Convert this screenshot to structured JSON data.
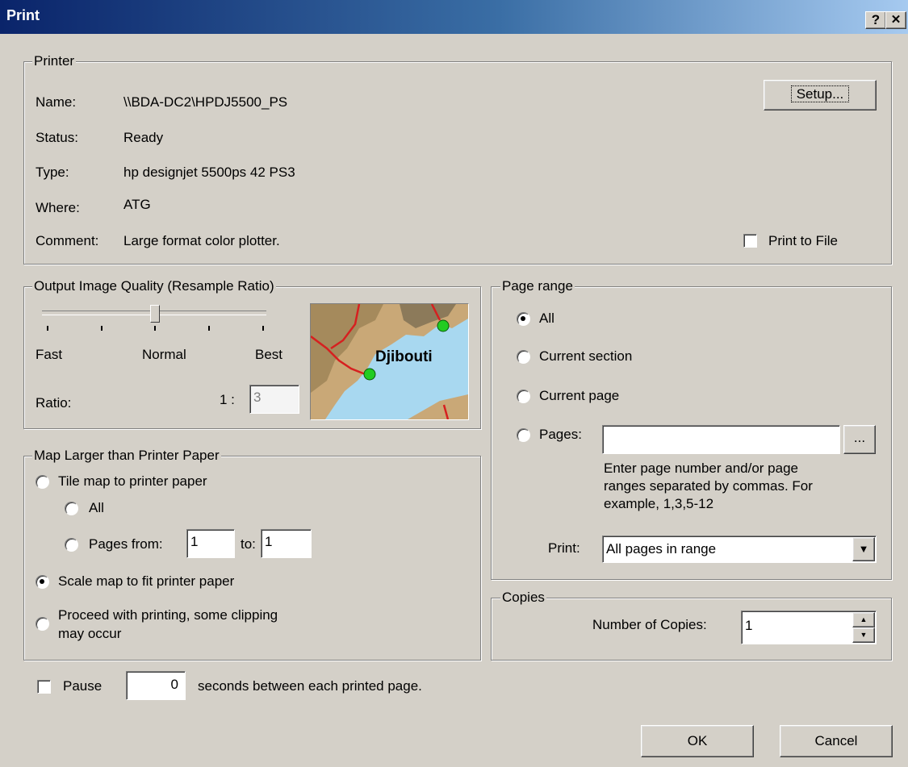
{
  "window": {
    "title": "Print",
    "help_label": "?",
    "close_label": "✕"
  },
  "printer": {
    "legend": "Printer",
    "labels": {
      "name": "Name:",
      "status": "Status:",
      "type": "Type:",
      "where": "Where:",
      "comment": "Comment:"
    },
    "values": {
      "name": "\\\\BDA-DC2\\HPDJ5500_PS",
      "status": "Ready",
      "type": "hp designjet 5500ps 42 PS3",
      "where": "ATG",
      "comment": "Large format color plotter."
    },
    "setup_label": "Setup...",
    "print_to_file_label": "Print to File",
    "print_to_file_checked": false
  },
  "quality": {
    "legend": "Output Image Quality (Resample Ratio)",
    "fast": "Fast",
    "normal": "Normal",
    "best": "Best",
    "slider_level": 0.5,
    "ratio_label": "Ratio:",
    "ratio_prefix": "1 :",
    "ratio_value": "3",
    "preview_label": "Djibouti"
  },
  "map_larger": {
    "legend": "Map Larger than Printer Paper",
    "tile_label": "Tile map to printer paper",
    "all_label": "All",
    "pages_from_label": "Pages from:",
    "pages_from_value": "1",
    "to_label": "to:",
    "to_value": "1",
    "scale_label": "Scale map to fit printer paper",
    "proceed_label_1": "Proceed with printing, some clipping",
    "proceed_label_2": "may occur",
    "selected": "scale"
  },
  "page_range": {
    "legend": "Page range",
    "all_label": "All",
    "current_section_label": "Current section",
    "current_page_label": "Current page",
    "pages_label": "Pages:",
    "pages_value": "",
    "browse_label": "...",
    "hint_1": "Enter page number and/or page",
    "hint_2": "ranges separated by commas.  For",
    "hint_3": "example, 1,3,5-12",
    "print_label": "Print:",
    "print_value": "All pages in range",
    "selected": "all"
  },
  "copies": {
    "legend": "Copies",
    "number_label": "Number of Copies:",
    "value": "1"
  },
  "pause": {
    "label": "Pause",
    "value": "0",
    "suffix": "seconds between each printed page.",
    "checked": false
  },
  "buttons": {
    "ok": "OK",
    "cancel": "Cancel"
  }
}
